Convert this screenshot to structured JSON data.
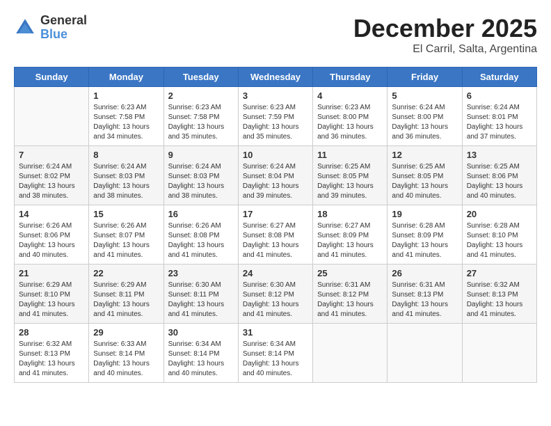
{
  "logo": {
    "general": "General",
    "blue": "Blue"
  },
  "title": "December 2025",
  "subtitle": "El Carril, Salta, Argentina",
  "weekdays": [
    "Sunday",
    "Monday",
    "Tuesday",
    "Wednesday",
    "Thursday",
    "Friday",
    "Saturday"
  ],
  "weeks": [
    [
      {
        "day": "",
        "sunrise": "",
        "sunset": "",
        "daylight": ""
      },
      {
        "day": "1",
        "sunrise": "Sunrise: 6:23 AM",
        "sunset": "Sunset: 7:58 PM",
        "daylight": "Daylight: 13 hours and 34 minutes."
      },
      {
        "day": "2",
        "sunrise": "Sunrise: 6:23 AM",
        "sunset": "Sunset: 7:58 PM",
        "daylight": "Daylight: 13 hours and 35 minutes."
      },
      {
        "day": "3",
        "sunrise": "Sunrise: 6:23 AM",
        "sunset": "Sunset: 7:59 PM",
        "daylight": "Daylight: 13 hours and 35 minutes."
      },
      {
        "day": "4",
        "sunrise": "Sunrise: 6:23 AM",
        "sunset": "Sunset: 8:00 PM",
        "daylight": "Daylight: 13 hours and 36 minutes."
      },
      {
        "day": "5",
        "sunrise": "Sunrise: 6:24 AM",
        "sunset": "Sunset: 8:00 PM",
        "daylight": "Daylight: 13 hours and 36 minutes."
      },
      {
        "day": "6",
        "sunrise": "Sunrise: 6:24 AM",
        "sunset": "Sunset: 8:01 PM",
        "daylight": "Daylight: 13 hours and 37 minutes."
      }
    ],
    [
      {
        "day": "7",
        "sunrise": "Sunrise: 6:24 AM",
        "sunset": "Sunset: 8:02 PM",
        "daylight": "Daylight: 13 hours and 38 minutes."
      },
      {
        "day": "8",
        "sunrise": "Sunrise: 6:24 AM",
        "sunset": "Sunset: 8:03 PM",
        "daylight": "Daylight: 13 hours and 38 minutes."
      },
      {
        "day": "9",
        "sunrise": "Sunrise: 6:24 AM",
        "sunset": "Sunset: 8:03 PM",
        "daylight": "Daylight: 13 hours and 38 minutes."
      },
      {
        "day": "10",
        "sunrise": "Sunrise: 6:24 AM",
        "sunset": "Sunset: 8:04 PM",
        "daylight": "Daylight: 13 hours and 39 minutes."
      },
      {
        "day": "11",
        "sunrise": "Sunrise: 6:25 AM",
        "sunset": "Sunset: 8:05 PM",
        "daylight": "Daylight: 13 hours and 39 minutes."
      },
      {
        "day": "12",
        "sunrise": "Sunrise: 6:25 AM",
        "sunset": "Sunset: 8:05 PM",
        "daylight": "Daylight: 13 hours and 40 minutes."
      },
      {
        "day": "13",
        "sunrise": "Sunrise: 6:25 AM",
        "sunset": "Sunset: 8:06 PM",
        "daylight": "Daylight: 13 hours and 40 minutes."
      }
    ],
    [
      {
        "day": "14",
        "sunrise": "Sunrise: 6:26 AM",
        "sunset": "Sunset: 8:06 PM",
        "daylight": "Daylight: 13 hours and 40 minutes."
      },
      {
        "day": "15",
        "sunrise": "Sunrise: 6:26 AM",
        "sunset": "Sunset: 8:07 PM",
        "daylight": "Daylight: 13 hours and 41 minutes."
      },
      {
        "day": "16",
        "sunrise": "Sunrise: 6:26 AM",
        "sunset": "Sunset: 8:08 PM",
        "daylight": "Daylight: 13 hours and 41 minutes."
      },
      {
        "day": "17",
        "sunrise": "Sunrise: 6:27 AM",
        "sunset": "Sunset: 8:08 PM",
        "daylight": "Daylight: 13 hours and 41 minutes."
      },
      {
        "day": "18",
        "sunrise": "Sunrise: 6:27 AM",
        "sunset": "Sunset: 8:09 PM",
        "daylight": "Daylight: 13 hours and 41 minutes."
      },
      {
        "day": "19",
        "sunrise": "Sunrise: 6:28 AM",
        "sunset": "Sunset: 8:09 PM",
        "daylight": "Daylight: 13 hours and 41 minutes."
      },
      {
        "day": "20",
        "sunrise": "Sunrise: 6:28 AM",
        "sunset": "Sunset: 8:10 PM",
        "daylight": "Daylight: 13 hours and 41 minutes."
      }
    ],
    [
      {
        "day": "21",
        "sunrise": "Sunrise: 6:29 AM",
        "sunset": "Sunset: 8:10 PM",
        "daylight": "Daylight: 13 hours and 41 minutes."
      },
      {
        "day": "22",
        "sunrise": "Sunrise: 6:29 AM",
        "sunset": "Sunset: 8:11 PM",
        "daylight": "Daylight: 13 hours and 41 minutes."
      },
      {
        "day": "23",
        "sunrise": "Sunrise: 6:30 AM",
        "sunset": "Sunset: 8:11 PM",
        "daylight": "Daylight: 13 hours and 41 minutes."
      },
      {
        "day": "24",
        "sunrise": "Sunrise: 6:30 AM",
        "sunset": "Sunset: 8:12 PM",
        "daylight": "Daylight: 13 hours and 41 minutes."
      },
      {
        "day": "25",
        "sunrise": "Sunrise: 6:31 AM",
        "sunset": "Sunset: 8:12 PM",
        "daylight": "Daylight: 13 hours and 41 minutes."
      },
      {
        "day": "26",
        "sunrise": "Sunrise: 6:31 AM",
        "sunset": "Sunset: 8:13 PM",
        "daylight": "Daylight: 13 hours and 41 minutes."
      },
      {
        "day": "27",
        "sunrise": "Sunrise: 6:32 AM",
        "sunset": "Sunset: 8:13 PM",
        "daylight": "Daylight: 13 hours and 41 minutes."
      }
    ],
    [
      {
        "day": "28",
        "sunrise": "Sunrise: 6:32 AM",
        "sunset": "Sunset: 8:13 PM",
        "daylight": "Daylight: 13 hours and 41 minutes."
      },
      {
        "day": "29",
        "sunrise": "Sunrise: 6:33 AM",
        "sunset": "Sunset: 8:14 PM",
        "daylight": "Daylight: 13 hours and 40 minutes."
      },
      {
        "day": "30",
        "sunrise": "Sunrise: 6:34 AM",
        "sunset": "Sunset: 8:14 PM",
        "daylight": "Daylight: 13 hours and 40 minutes."
      },
      {
        "day": "31",
        "sunrise": "Sunrise: 6:34 AM",
        "sunset": "Sunset: 8:14 PM",
        "daylight": "Daylight: 13 hours and 40 minutes."
      },
      {
        "day": "",
        "sunrise": "",
        "sunset": "",
        "daylight": ""
      },
      {
        "day": "",
        "sunrise": "",
        "sunset": "",
        "daylight": ""
      },
      {
        "day": "",
        "sunrise": "",
        "sunset": "",
        "daylight": ""
      }
    ]
  ]
}
